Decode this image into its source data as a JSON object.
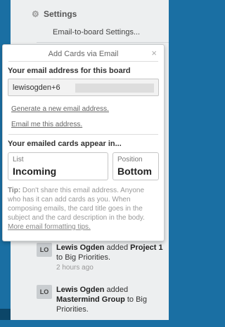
{
  "sidebar": {
    "settings_label": "Settings",
    "email_to_board_label": "Email-to-board Settings..."
  },
  "popup": {
    "title": "Add Cards via Email",
    "close_glyph": "×",
    "email_section_label": "Your email address for this board",
    "email_value": "lewisogden+6",
    "generate_link": "Generate a new email address.",
    "email_me_link": "Email me this address.",
    "cards_section_label": "Your emailed cards appear in...",
    "list_label": "List",
    "list_value": "Incoming",
    "position_label": "Position",
    "position_value": "Bottom",
    "tip_prefix": "Tip:",
    "tip_text": " Don't share this email address. Anyone who has it can add cards as you. When composing emails, the card title goes in the subject and the card description in the body.",
    "tip_link": "More email formatting tips."
  },
  "activity": [
    {
      "initials": "LO",
      "user": "Lewis Ogden",
      "action": " added ",
      "card": "Project 1",
      "rest": " to Big Priorities.",
      "time": "2 hours ago"
    },
    {
      "initials": "LO",
      "user": "Lewis Ogden",
      "action": " added ",
      "card": "Mastermind Group",
      "rest": " to Big Priorities."
    }
  ],
  "icons": {
    "gear": "gear-icon",
    "close": "close-icon"
  },
  "colors": {
    "board_background": "#1a6fa3",
    "sidebar_background": "#edeff0"
  }
}
